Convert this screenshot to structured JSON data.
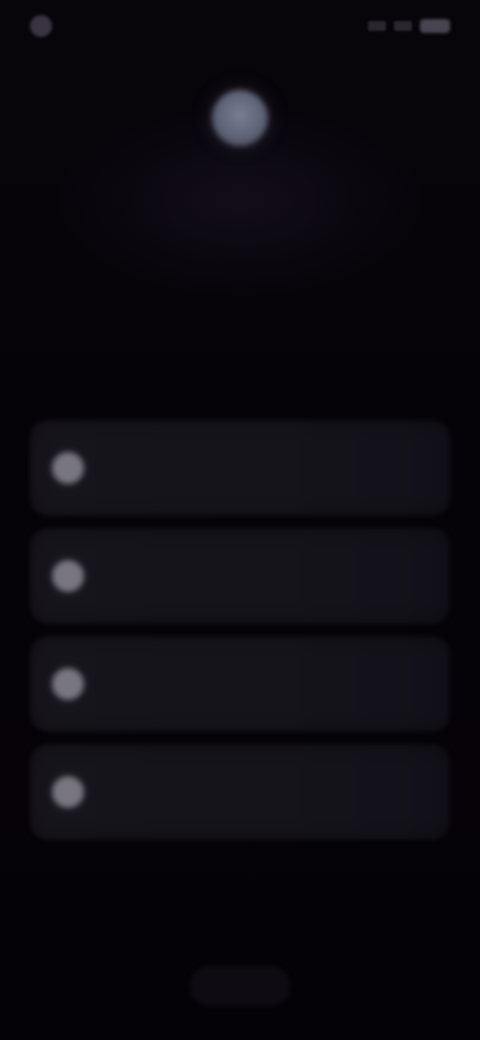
{
  "status_bar": {
    "time": "",
    "avatar_icon": "avatar-icon",
    "battery_icon": "battery-icon"
  },
  "header": {
    "icon": "globe-icon",
    "headline": ""
  },
  "options": [
    {
      "label": "",
      "icon": "circle-icon"
    },
    {
      "label": "",
      "icon": "circle-icon"
    },
    {
      "label": "",
      "icon": "circle-icon"
    },
    {
      "label": "",
      "icon": "circle-icon"
    }
  ],
  "footer": {
    "button_label": ""
  },
  "colors": {
    "background": "#060308",
    "card": "#17151c",
    "icon": "#8a8792",
    "hero": "#6b7083"
  }
}
